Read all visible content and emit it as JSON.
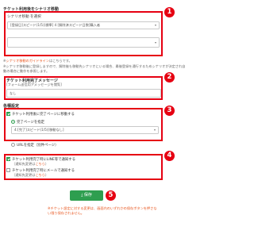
{
  "section1": {
    "title": "チケット利用後をシナリオ移動",
    "select_label": "シナリオ移動 を選択",
    "select_value": "[登録日]スピード(1/5)[標準] 4 [解除済スピード日数]購入者",
    "second_select_value": "",
    "link_prefix": "※",
    "link_text": "シナリオ移動のガイドライン",
    "link_suffix": "はこちらです。",
    "note": "※シナリオ移動後に登録しますので、解除後も移動先シナリオにいる場合、最後登録を通行するためシナリオが決定され自動の場合に動作を参照します。"
  },
  "section2": {
    "title": "チケット利用完了メッセージ",
    "link": "[フォーム送信用アメッセージを閲覧]",
    "value": "なし"
  },
  "section3": {
    "title": "各種設定",
    "checkbox_label": "チケット利用後に完了ページに移動する",
    "radio1_label": "完了ページを指定",
    "select_value": "4:[完了]スピード(1/5)[移動なし]",
    "radio2_label": "URLを指定（別件ページ）"
  },
  "section4": {
    "line1": "チケット利用完了時にLINE等で通知する",
    "line1_sub_prefix": "（通知先変更は",
    "line1_sub_link": "こちら",
    "line1_sub_suffix": "）",
    "line2": "チケット利用完了時にメールで通知する",
    "line2_sub_prefix": "（通知先変更は",
    "line2_sub_link": "こちら",
    "line2_sub_suffix": "）"
  },
  "save_button": {
    "icon": "download-icon",
    "label": "保存"
  },
  "warning": "※チケット設定に対する変更は、画面内のいずれかの保存ボタンを押さない限り保存されません。",
  "badges": [
    "1",
    "2",
    "3",
    "4",
    "5"
  ],
  "colors": {
    "highlight": "#e60012",
    "accent_green": "#2e9e4f",
    "link_orange": "#e8541c"
  }
}
